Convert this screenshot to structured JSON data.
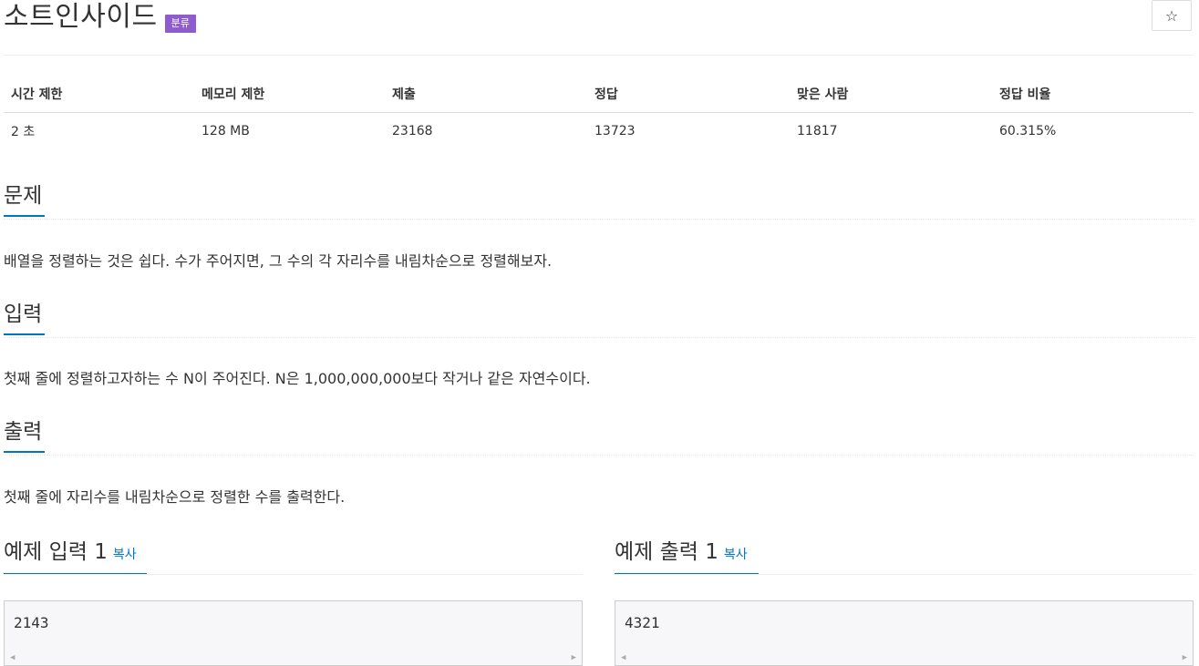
{
  "problem": {
    "title": "소트인사이드",
    "badge": "분류",
    "star": "☆"
  },
  "info_table": {
    "headers": [
      "시간 제한",
      "메모리 제한",
      "제출",
      "정답",
      "맞은 사람",
      "정답 비율"
    ],
    "values": [
      "2 초",
      "128 MB",
      "23168",
      "13723",
      "11817",
      "60.315%"
    ]
  },
  "sections": {
    "problem": {
      "heading": "문제",
      "text": "배열을 정렬하는 것은 쉽다. 수가 주어지면, 그 수의 각 자리수를 내림차순으로 정렬해보자."
    },
    "input": {
      "heading": "입력",
      "text": "첫째 줄에 정렬하고자하는 수 N이 주어진다. N은 1,000,000,000보다 작거나 같은 자연수이다."
    },
    "output": {
      "heading": "출력",
      "text": "첫째 줄에 자리수를 내림차순으로 정렬한 수를 출력한다."
    }
  },
  "examples": {
    "input": {
      "heading": "예제 입력 1",
      "copy": "복사",
      "value": "2143"
    },
    "output": {
      "heading": "예제 출력 1",
      "copy": "복사",
      "value": "4321"
    }
  }
}
